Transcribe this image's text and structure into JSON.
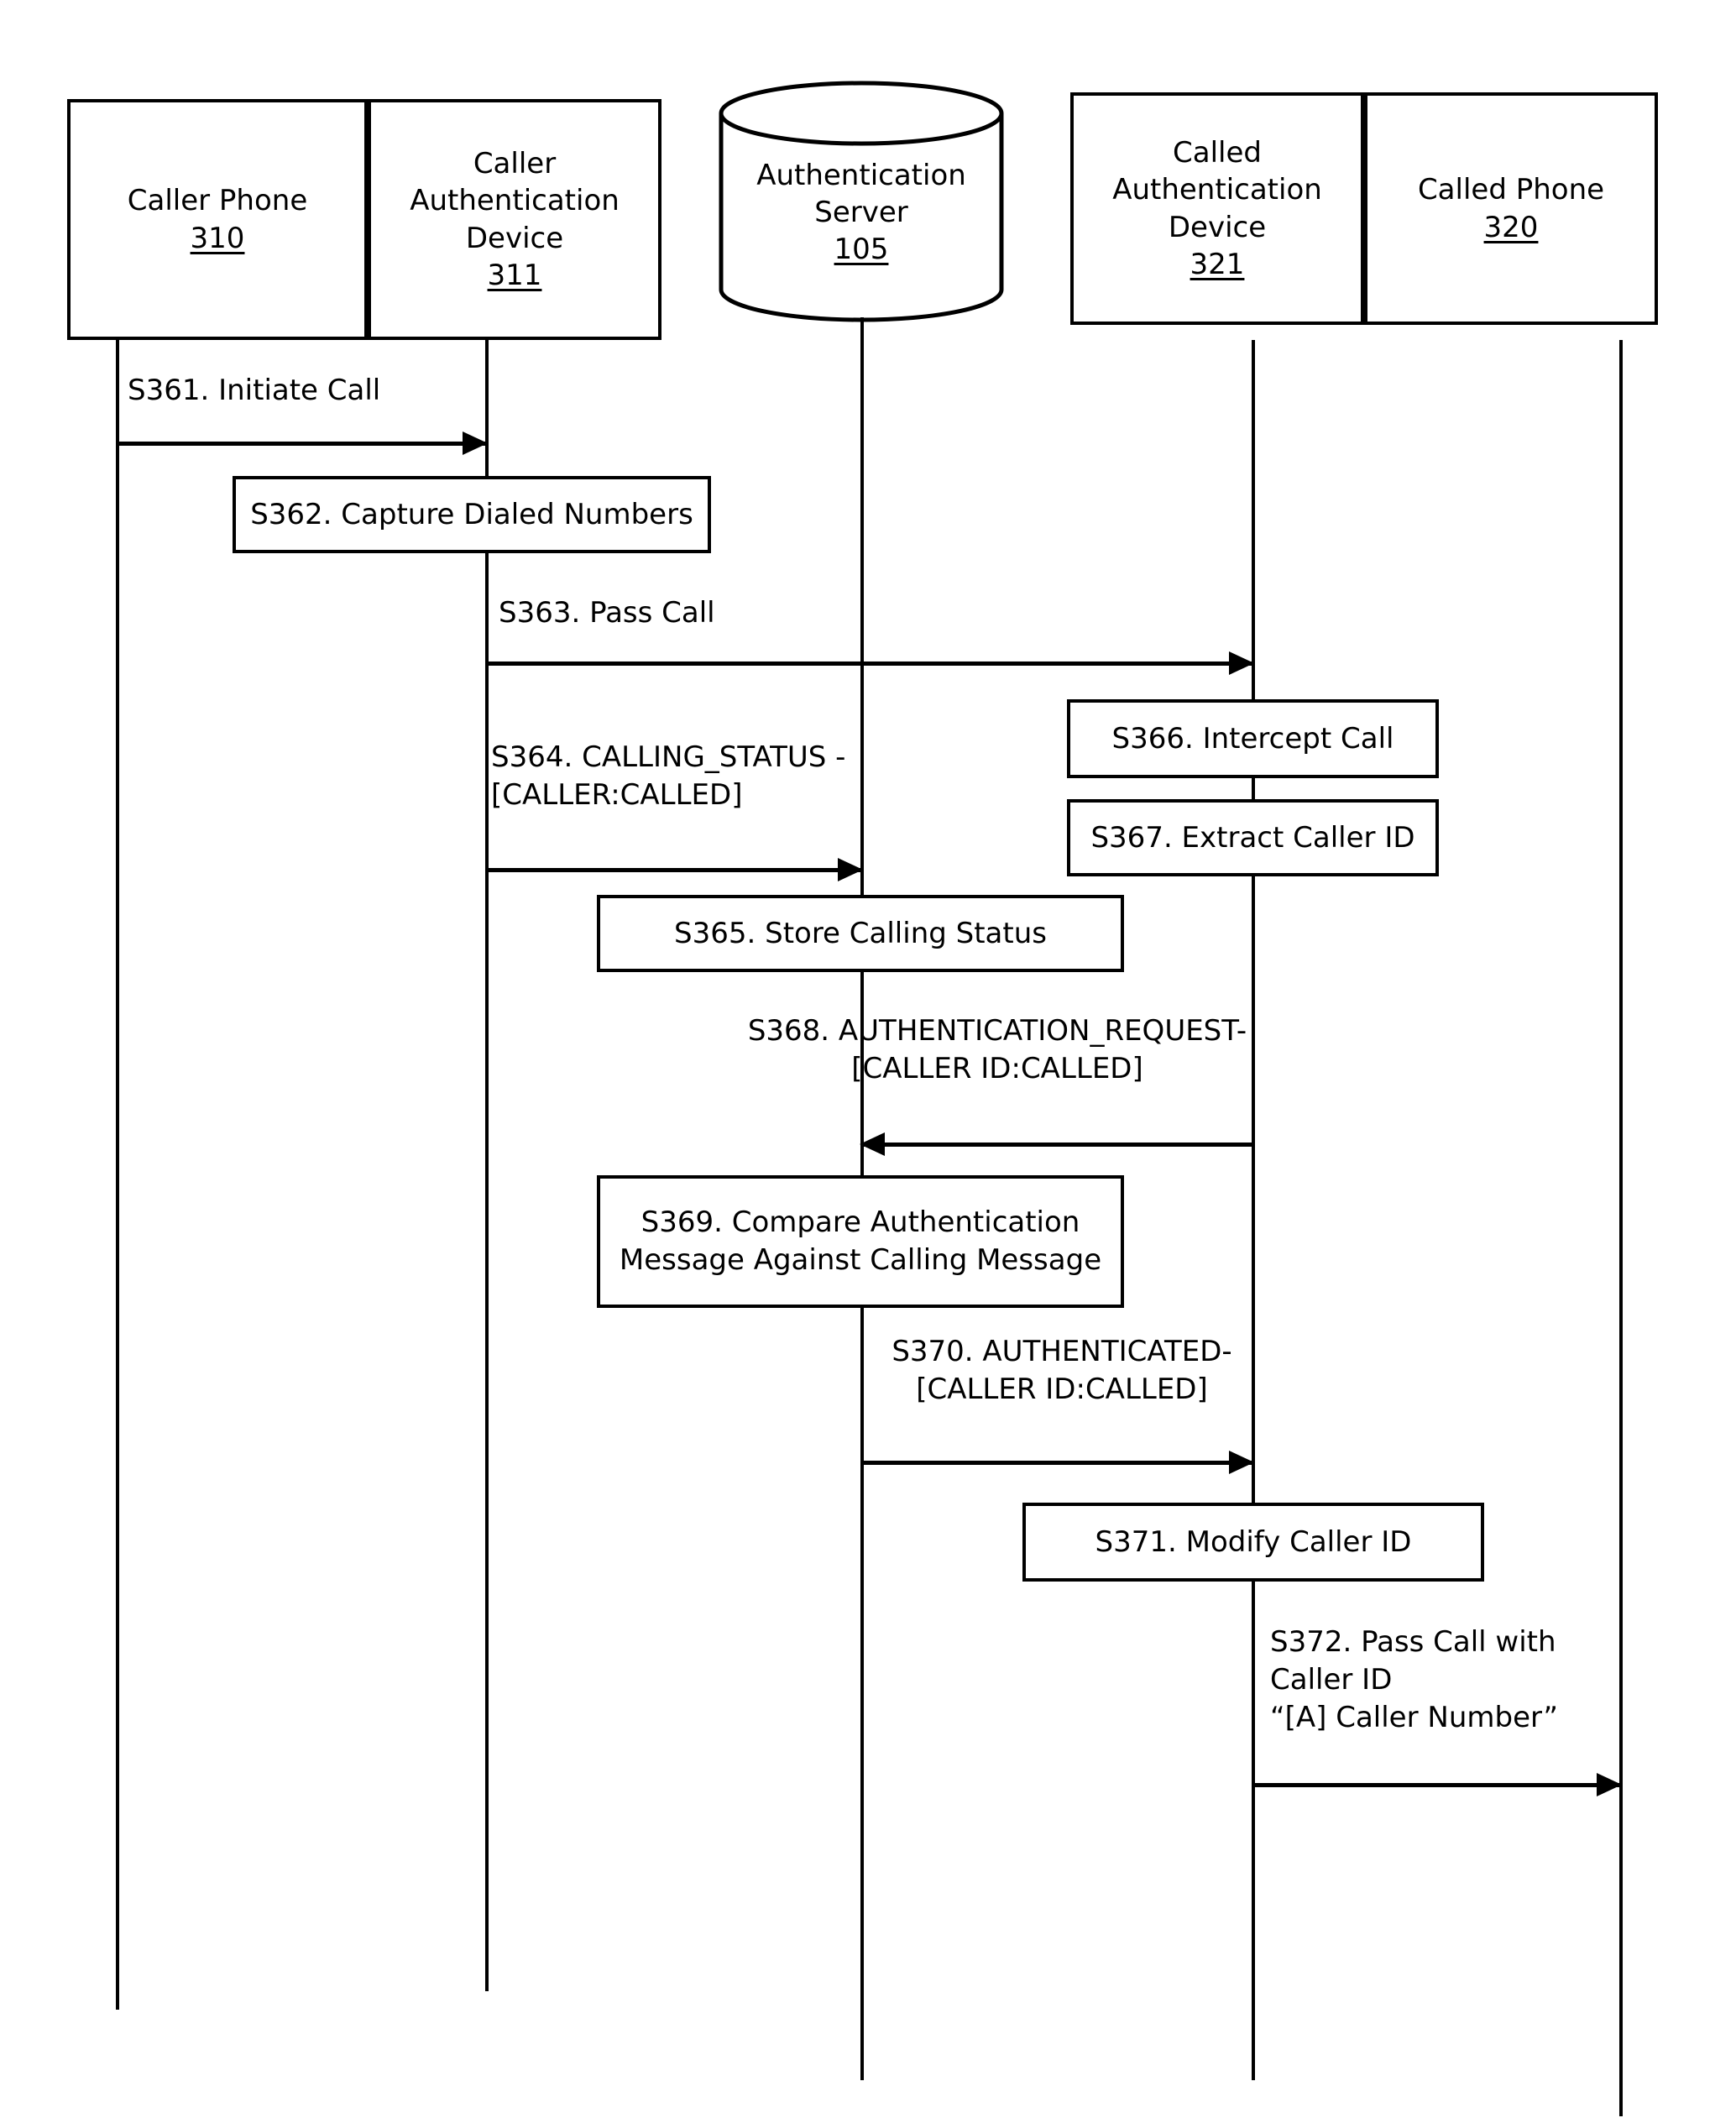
{
  "diagram": {
    "title": "Caller authentication call-flow sequence diagram",
    "participants": [
      {
        "id": "caller_phone",
        "name": "Caller Phone",
        "ref": "310",
        "shape": "box"
      },
      {
        "id": "caller_auth_device",
        "name": "Caller\nAuthentication\nDevice",
        "ref": "311",
        "shape": "box"
      },
      {
        "id": "auth_server",
        "name": "Authentication\nServer",
        "ref": "105",
        "shape": "cylinder"
      },
      {
        "id": "called_auth_device",
        "name": "Called\nAuthentication\nDevice",
        "ref": "321",
        "shape": "box"
      },
      {
        "id": "called_phone",
        "name": "Called Phone",
        "ref": "320",
        "shape": "box"
      }
    ],
    "messages": [
      {
        "id": "s361",
        "label": "S361. Initiate Call",
        "from": "caller_phone",
        "to": "caller_auth_device",
        "direction": "right"
      },
      {
        "id": "s363",
        "label": "S363. Pass Call",
        "from": "caller_auth_device",
        "to": "called_auth_device",
        "direction": "right"
      },
      {
        "id": "s364",
        "label": "S364. CALLING_STATUS -\n[CALLER:CALLED]",
        "from": "caller_auth_device",
        "to": "auth_server",
        "direction": "right"
      },
      {
        "id": "s368",
        "label": "S368. AUTHENTICATION_REQUEST-\n[CALLER ID:CALLED]",
        "from": "called_auth_device",
        "to": "auth_server",
        "direction": "left"
      },
      {
        "id": "s370",
        "label": "S370. AUTHENTICATED-\n[CALLER ID:CALLED]",
        "from": "auth_server",
        "to": "called_auth_device",
        "direction": "right"
      },
      {
        "id": "s372",
        "label": "S372. Pass Call with\nCaller ID\n“[A] Caller Number”",
        "from": "called_auth_device",
        "to": "called_phone",
        "direction": "right"
      }
    ],
    "actions": [
      {
        "id": "s362",
        "label": "S362. Capture Dialed Numbers",
        "on": "caller_auth_device"
      },
      {
        "id": "s365",
        "label": "S365. Store Calling Status",
        "on": "auth_server"
      },
      {
        "id": "s366",
        "label": "S366. Intercept Call",
        "on": "called_auth_device"
      },
      {
        "id": "s367",
        "label": "S367. Extract Caller ID",
        "on": "called_auth_device"
      },
      {
        "id": "s369",
        "label": "S369. Compare Authentication\nMessage Against Calling Message",
        "on": "auth_server"
      },
      {
        "id": "s371",
        "label": "S371. Modify Caller ID",
        "on": "called_auth_device"
      }
    ],
    "colors": {
      "stroke": "#000000",
      "background": "#ffffff"
    }
  }
}
